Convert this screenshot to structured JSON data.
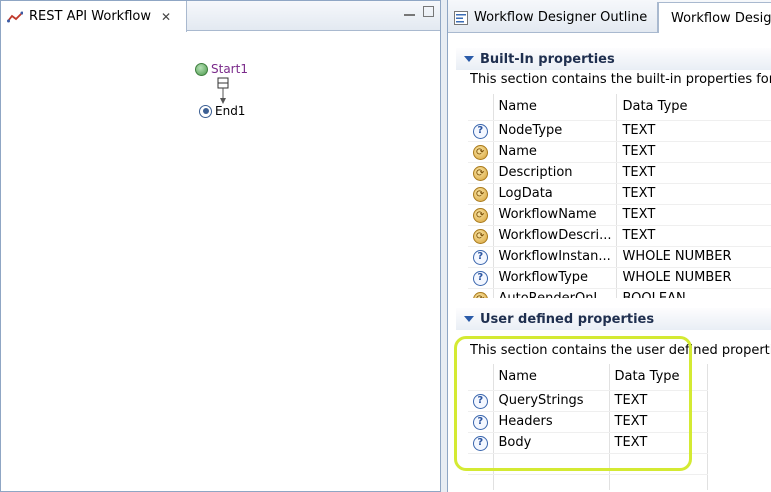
{
  "editor": {
    "tab_title": "REST API Workflow",
    "close_symbol": "✕"
  },
  "canvas": {
    "start_label": "Start1",
    "end_label": "End1"
  },
  "right": {
    "tabs": [
      {
        "label": "Workflow Designer Outline"
      },
      {
        "label": "Workflow Designer Properties"
      }
    ],
    "builtin": {
      "header": "Built-In properties",
      "description": "This section contains the built-in properties for",
      "col_name": "Name",
      "col_type": "Data Type",
      "rows": [
        {
          "icon": "question",
          "name": "NodeType",
          "type": "TEXT"
        },
        {
          "icon": "cycle",
          "name": "Name",
          "type": "TEXT"
        },
        {
          "icon": "cycle",
          "name": "Description",
          "type": "TEXT"
        },
        {
          "icon": "cycle",
          "name": "LogData",
          "type": "TEXT"
        },
        {
          "icon": "cycle",
          "name": "WorkflowName",
          "type": "TEXT"
        },
        {
          "icon": "cycle",
          "name": "WorkflowDescri...",
          "type": "TEXT"
        },
        {
          "icon": "question",
          "name": "WorkflowInstan...",
          "type": "WHOLE NUMBER"
        },
        {
          "icon": "question",
          "name": "WorkflowType",
          "type": "WHOLE NUMBER"
        },
        {
          "icon": "cycle",
          "name": "AutoRenderOnI...",
          "type": "BOOLEAN"
        }
      ]
    },
    "user": {
      "header": "User defined properties",
      "description": "This section contains the user defined properti",
      "col_name": "Name",
      "col_type": "Data Type",
      "rows": [
        {
          "icon": "question",
          "name": "QueryStrings",
          "type": "TEXT"
        },
        {
          "icon": "question",
          "name": "Headers",
          "type": "TEXT"
        },
        {
          "icon": "question",
          "name": "Body",
          "type": "TEXT"
        }
      ]
    }
  },
  "colors": {
    "highlight": "#d4ea33",
    "start_label": "#7a2a8a"
  }
}
